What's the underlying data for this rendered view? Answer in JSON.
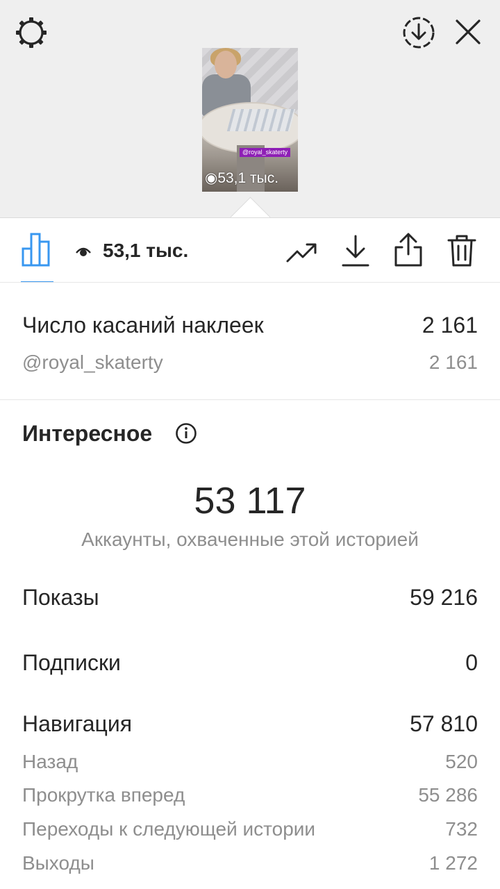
{
  "story": {
    "thumbnail_tag": "@royal_skaterty",
    "thumbnail_views": "53,1 тыс."
  },
  "toolbar": {
    "views_count": "53,1 тыс."
  },
  "icons": {
    "settings": "gear-icon",
    "download_circle": "download-circle-icon",
    "close": "close-icon",
    "insights": "bar-chart-icon",
    "views": "eye-icon",
    "promote": "trend-up-icon",
    "download": "download-icon",
    "share": "share-icon",
    "delete": "trash-icon",
    "info": "info-icon"
  },
  "sticker_taps": {
    "label": "Число касаний наклеек",
    "value": "2 161",
    "items": [
      {
        "label": "@royal_skaterty",
        "value": "2 161"
      }
    ]
  },
  "discovery": {
    "title": "Интересное",
    "reach_value": "53 117",
    "reach_caption": "Аккаунты, охваченные этой историей",
    "impressions_label": "Показы",
    "impressions_value": "59 216",
    "follows_label": "Подписки",
    "follows_value": "0"
  },
  "navigation": {
    "label": "Навигация",
    "value": "57 810",
    "items": [
      {
        "label": "Назад",
        "value": "520"
      },
      {
        "label": "Прокрутка вперед",
        "value": "55 286"
      },
      {
        "label": "Переходы к следующей истории",
        "value": "732"
      },
      {
        "label": "Выходы",
        "value": "1 272"
      }
    ]
  },
  "colors": {
    "accent": "#3897f0",
    "tag_bg": "#8e1fb5",
    "secondary_text": "#8e8e8e",
    "primary_text": "#262626"
  }
}
